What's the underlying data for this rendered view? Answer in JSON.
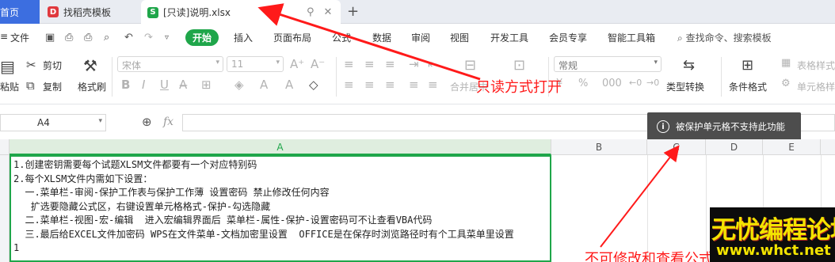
{
  "tabs": {
    "home": "首页",
    "template": "找稻壳模板",
    "doc": "[只读]说明.xlsx"
  },
  "menu": {
    "file": "文件",
    "start": "开始",
    "insert": "插入",
    "page_layout": "页面布局",
    "formula": "公式",
    "data": "数据",
    "review": "审阅",
    "view": "视图",
    "dev_tools": "开发工具",
    "vip": "会员专享",
    "smart_toolbox": "智能工具箱",
    "search": "查找命令、搜索模板"
  },
  "ribbon": {
    "paste": "粘贴",
    "cut": "剪切",
    "copy": "复制",
    "format_painter": "格式刷",
    "font_name": "宋体",
    "font_size": "11",
    "merge_center": "合并居中",
    "number_format": "常规",
    "type_convert": "类型转换",
    "cond_format": "条件格式",
    "table_style": "表格样式",
    "cell_style": "单元格样"
  },
  "formula_bar": {
    "cell_ref": "A4",
    "fx": "fx",
    "value": ""
  },
  "tooltip": {
    "text": "被保护单元格不支持此功能"
  },
  "grid": {
    "columns": [
      "A",
      "B",
      "C",
      "D",
      "E"
    ],
    "cellA_text": "1.创建密钥需要每个试题XLSM文件都要有一个对应特别码\n2.每个XLSM文件内需如下设置：\n  一.菜单栏-审阅-保护工作表与保护工作薄 设置密码 禁止修改任何内容\n   扩选要隐藏公式区，右键设置单元格格式-保护-勾选隐藏\n  二.菜单栏-视图-宏-编辑  进入宏编辑界面后 菜单栏-属性-保护-设置密码可不让查看VBA代码\n  三.最后给EXCEL文件加密码 WPS在文件菜单-文档加密里设置  OFFICE是在保存时浏览路径时有个工具菜单里设置\n1"
  },
  "annotations": {
    "readonly_note": "只读方式打开",
    "bottom_note": "不可修改和查看公式与代码",
    "watermark_title": "无忧编程论坛",
    "watermark_url": "www.whct.net"
  },
  "colors": {
    "accent_green": "#1fa64a",
    "annotation_red": "#ff1a1a",
    "home_tab_blue": "#3c6ee0"
  }
}
